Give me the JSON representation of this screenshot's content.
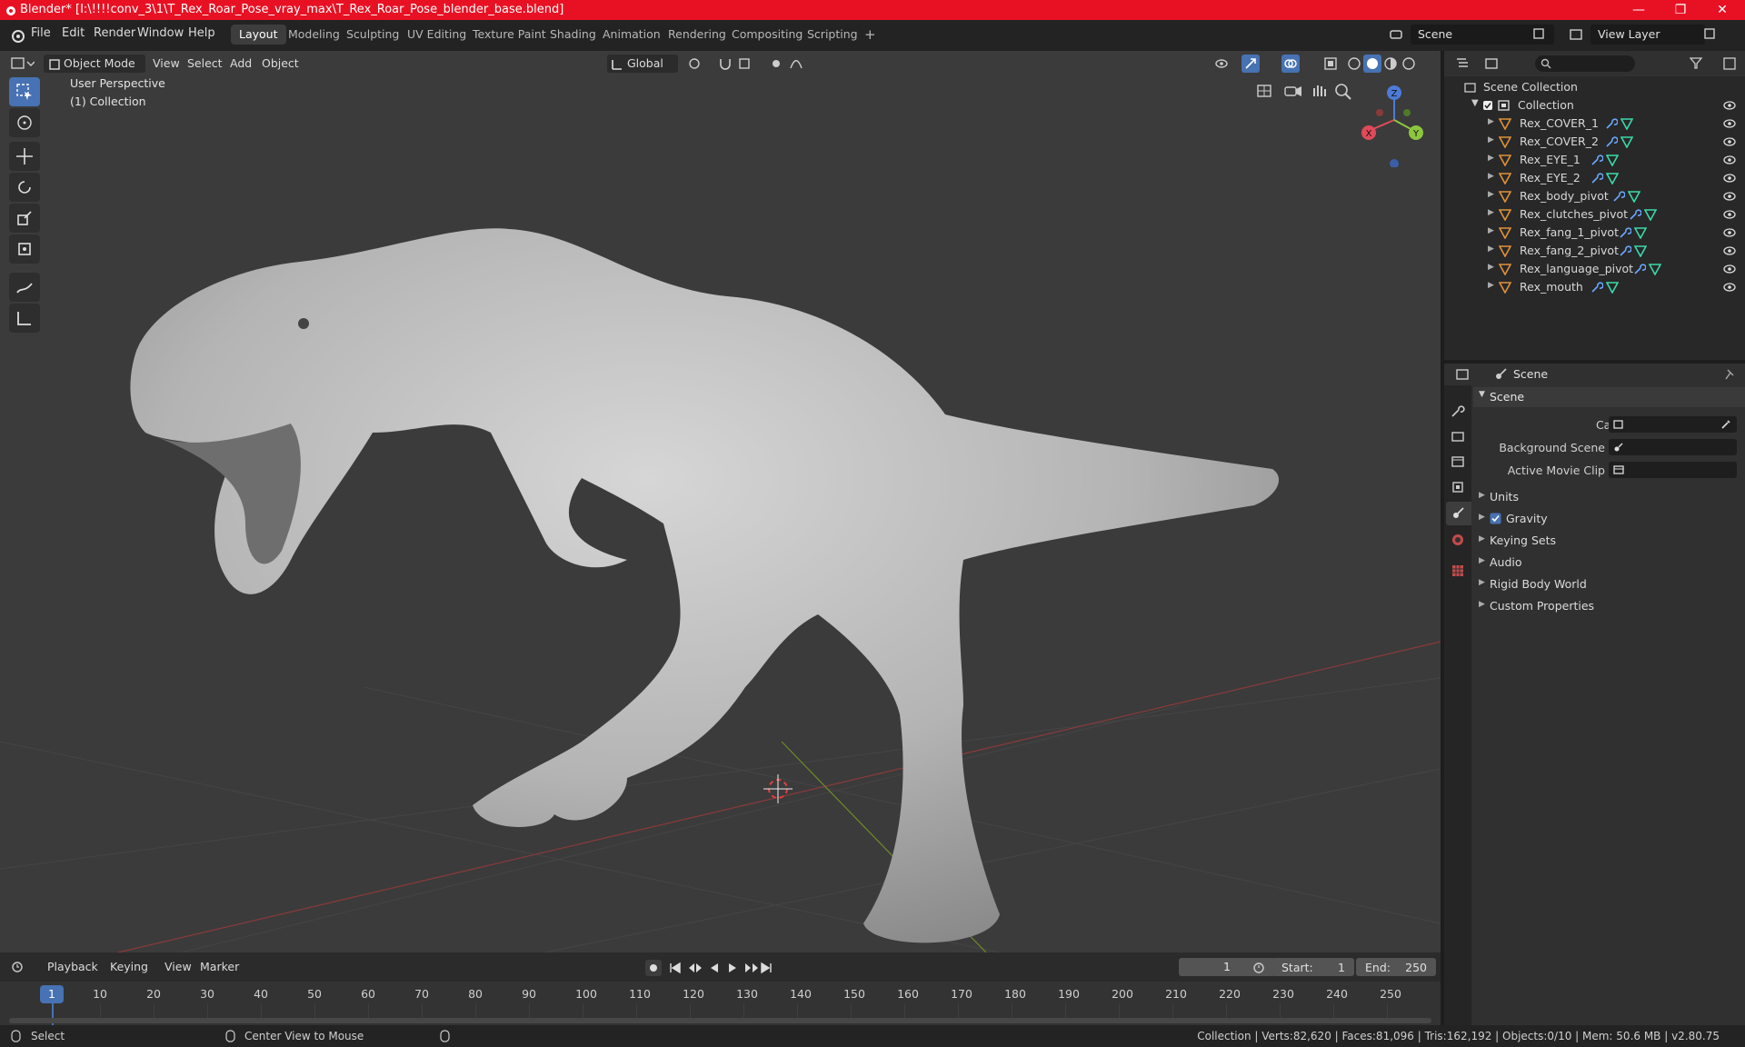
{
  "window": {
    "title": "Blender* [I:\\!!!!conv_3\\1\\T_Rex_Roar_Pose_vray_max\\T_Rex_Roar_Pose_blender_base.blend]",
    "min_label": "—",
    "max_label": "❐",
    "close_label": "✕"
  },
  "menu": [
    "File",
    "Edit",
    "Render",
    "Window",
    "Help"
  ],
  "workspaces": [
    "Layout",
    "Modeling",
    "Sculpting",
    "UV Editing",
    "Texture Paint",
    "Shading",
    "Animation",
    "Rendering",
    "Compositing",
    "Scripting"
  ],
  "active_workspace": "Layout",
  "add_workspace": "+",
  "scene_name": "Scene",
  "view_layer": "View Layer",
  "viewport": {
    "mode": "Object Mode",
    "menus": [
      "View",
      "Select",
      "Add",
      "Object"
    ],
    "orientation": "Global",
    "perspective": "User Perspective",
    "collection": "(1) Collection",
    "gizmo": {
      "x": "X",
      "y": "Y",
      "z": "Z"
    }
  },
  "outliner": {
    "root": "Scene Collection",
    "collection": "Collection",
    "objects": [
      "Rex_COVER_1",
      "Rex_COVER_2",
      "Rex_EYE_1",
      "Rex_EYE_2",
      "Rex_body_pivot",
      "Rex_clutches_pivot",
      "Rex_fang_1_pivot",
      "Rex_fang_2_pivot",
      "Rex_language_pivot",
      "Rex_mouth"
    ]
  },
  "properties": {
    "header": "Scene",
    "section": "Scene",
    "fields": {
      "camera": "Camera",
      "background_scene": "Background Scene",
      "active_movie_clip": "Active Movie Clip"
    },
    "panels": [
      "Units",
      "Gravity",
      "Keying Sets",
      "Audio",
      "Rigid Body World",
      "Custom Properties"
    ]
  },
  "timeline": {
    "menus": [
      "Playback",
      "Keying",
      "View",
      "Marker"
    ],
    "current_frame": "1",
    "start_label": "Start:",
    "start": "1",
    "end_label": "End:",
    "end": "250",
    "ticks": [
      "1",
      "10",
      "20",
      "30",
      "40",
      "50",
      "60",
      "70",
      "80",
      "90",
      "100",
      "110",
      "120",
      "130",
      "140",
      "150",
      "160",
      "170",
      "180",
      "190",
      "200",
      "210",
      "220",
      "230",
      "240",
      "250"
    ]
  },
  "statusbar": {
    "left": "Select",
    "middle": "Center View to Mouse",
    "right": "Collection | Verts:82,620 | Faces:81,096 | Tris:162,192 | Objects:0/10 | Mem: 50.6 MB | v2.80.75"
  },
  "colors": {
    "titlebar": "#e81123",
    "accent": "#4772b3",
    "mesh_icon": "#e0913a",
    "modifier_icon": "#6aa8ff",
    "data_icon": "#3bd8a8"
  }
}
